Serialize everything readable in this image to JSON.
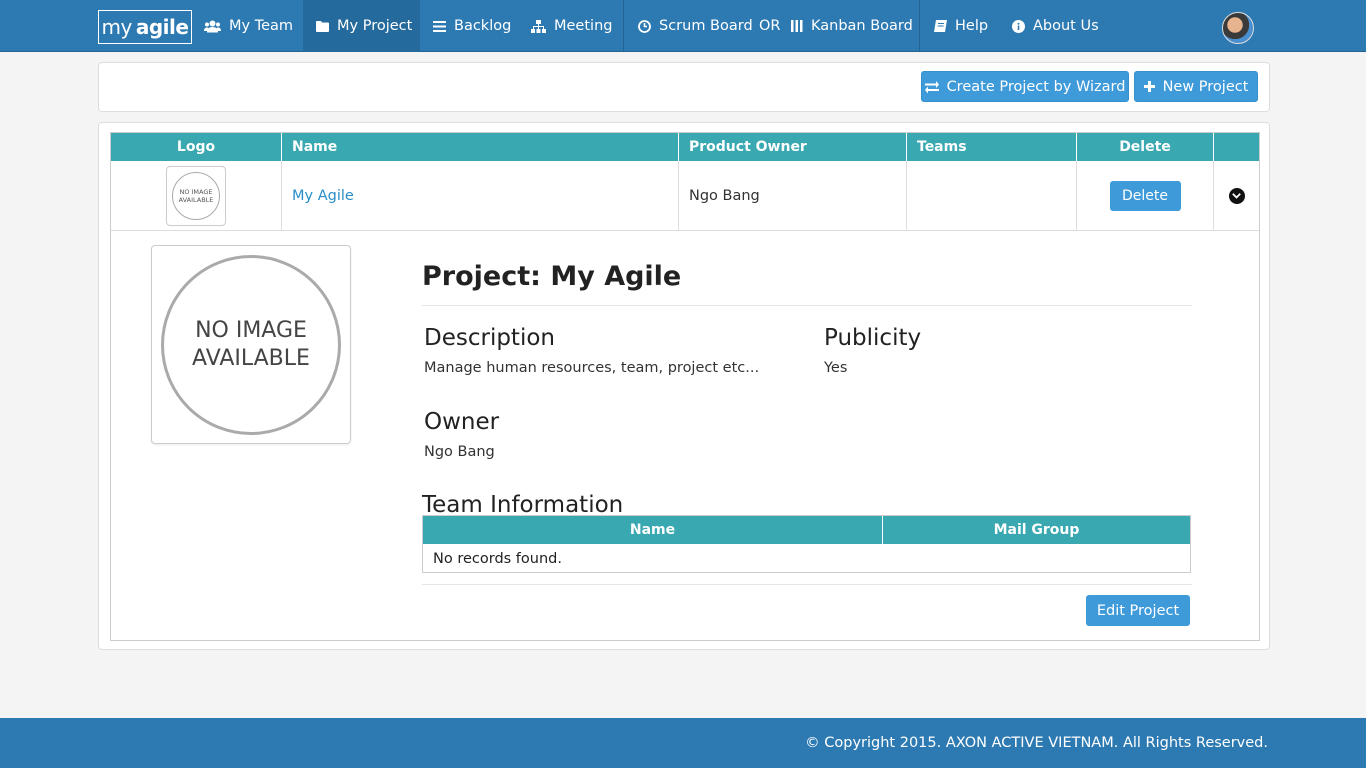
{
  "brand": {
    "my": "my",
    "agile": "agile"
  },
  "nav": {
    "my_team": "My Team",
    "my_project": "My Project",
    "backlog": "Backlog",
    "meeting": "Meeting",
    "scrum_board": "Scrum Board",
    "or": "OR",
    "kanban_board": "Kanban Board",
    "help": "Help",
    "about_us": "About Us"
  },
  "toolbar": {
    "wizard_label": "Create Project by Wizard",
    "new_project_label": "New Project"
  },
  "projects_table": {
    "columns": [
      "Logo",
      "Name",
      "Product Owner",
      "Teams",
      "Delete"
    ],
    "rows": [
      {
        "logo_text": "NO IMAGE AVAILABLE",
        "name": "My Agile",
        "product_owner": "Ngo Bang",
        "teams": "",
        "delete_label": "Delete"
      }
    ]
  },
  "detail": {
    "image_text": "NO IMAGE AVAILABLE",
    "title": "Project: My Agile",
    "description_label": "Description",
    "description_value": "Manage human resources, team, project etc...",
    "publicity_label": "Publicity",
    "publicity_value": "Yes",
    "owner_label": "Owner",
    "owner_value": "Ngo Bang",
    "team_info_title": "Team Information",
    "team_columns": [
      "Name",
      "Mail Group"
    ],
    "no_records": "No records found.",
    "edit_label": "Edit Project"
  },
  "footer": {
    "copyright": "© Copyright 2015. AXON ACTIVE VIETNAM. All Rights Reserved."
  },
  "colors": {
    "nav": "#2d7ab3",
    "table_header": "#3aa8b0",
    "button": "#3e9ad9",
    "link": "#2a8fc7"
  }
}
